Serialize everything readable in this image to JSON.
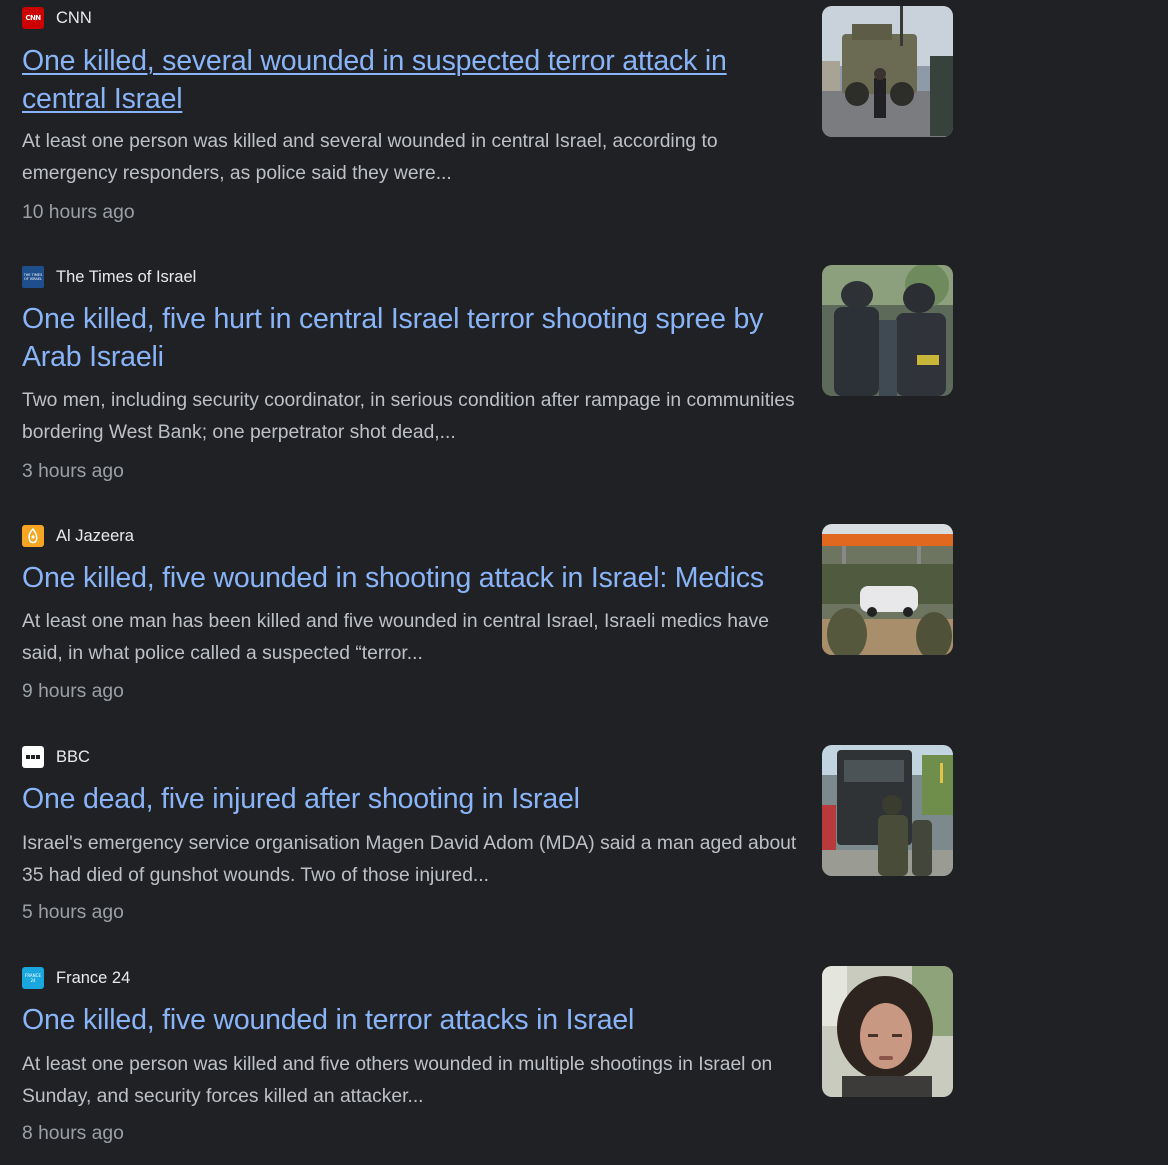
{
  "results": [
    {
      "source": "CNN",
      "favicon_text": "CNN",
      "title": "One killed, several wounded in suspected terror attack in central Israel",
      "snippet": "At least one person was killed and several wounded in central Israel, according to emergency responders, as police said they were...",
      "time": "10 hours ago",
      "thumbnail": "armored-vehicle-photo"
    },
    {
      "source": "The Times of Israel",
      "favicon_text": "THE TIMES OF ISRAEL",
      "title": "One killed, five hurt in central Israel terror shooting spree by Arab Israeli",
      "snippet": "Two men, including security coordinator, in serious condition after rampage in communities bordering West Bank; one perpetrator shot dead,...",
      "time": "3 hours ago",
      "thumbnail": "police-officers-photo"
    },
    {
      "source": "Al Jazeera",
      "favicon_text": "",
      "title": "One killed, five wounded in shooting attack in Israel: Medics",
      "snippet": "At least one man has been killed and five wounded in central Israel, Israeli medics have said, in what police called a suspected “terror...",
      "time": "9 hours ago",
      "thumbnail": "gas-station-soldiers-photo"
    },
    {
      "source": "BBC",
      "favicon_text": "",
      "title": "One dead, five injured after shooting in Israel",
      "snippet": "Israel's emergency service organisation Magen David Adom (MDA) said a man aged about 35 had died of gunshot wounds. Two of those injured...",
      "time": "5 hours ago",
      "thumbnail": "soldiers-armored-truck-photo"
    },
    {
      "source": "France 24",
      "favicon_text": "FRANCE 24",
      "title": "One killed, five wounded in terror attacks in Israel",
      "snippet": "At least one person was killed and five others wounded in multiple shootings in Israel on Sunday, and security forces killed an attacker...",
      "time": "8 hours ago",
      "thumbnail": "reporter-portrait-photo"
    }
  ],
  "colors": {
    "background": "#202124",
    "title_link": "#8ab4f8",
    "source_text": "#e8eaed",
    "snippet_text": "#bdc1c6",
    "time_text": "#9aa0a6",
    "cnn_red": "#cc0000",
    "aljazeera_orange": "#f6a623",
    "france24_blue": "#1aa7e0"
  }
}
